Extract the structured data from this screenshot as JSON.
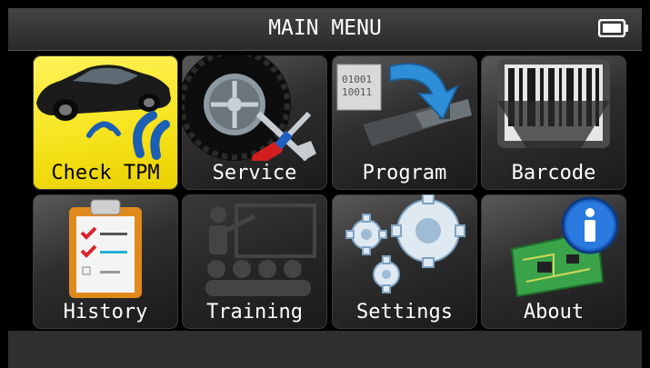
{
  "header": {
    "title": "MAIN MENU",
    "battery_icon": "battery-icon"
  },
  "menu": [
    {
      "id": "check-tpm",
      "label": "Check TPM",
      "icon": "car-sensor-icon",
      "state": "selected"
    },
    {
      "id": "service",
      "label": "Service",
      "icon": "tire-tools-icon",
      "state": "enabled"
    },
    {
      "id": "program",
      "label": "Program",
      "icon": "sensor-program-icon",
      "state": "enabled"
    },
    {
      "id": "barcode",
      "label": "Barcode",
      "icon": "barcode-scanner-icon",
      "state": "enabled"
    },
    {
      "id": "history",
      "label": "History",
      "icon": "clipboard-checklist-icon",
      "state": "enabled"
    },
    {
      "id": "training",
      "label": "Training",
      "icon": "classroom-icon",
      "state": "disabled"
    },
    {
      "id": "settings",
      "label": "Settings",
      "icon": "gears-icon",
      "state": "enabled"
    },
    {
      "id": "about",
      "label": "About",
      "icon": "info-board-icon",
      "state": "enabled"
    }
  ],
  "colors": {
    "selected_tile": "#f6e21a",
    "tile": "#3a3a3a",
    "background": "#000000",
    "text": "#ffffff"
  }
}
